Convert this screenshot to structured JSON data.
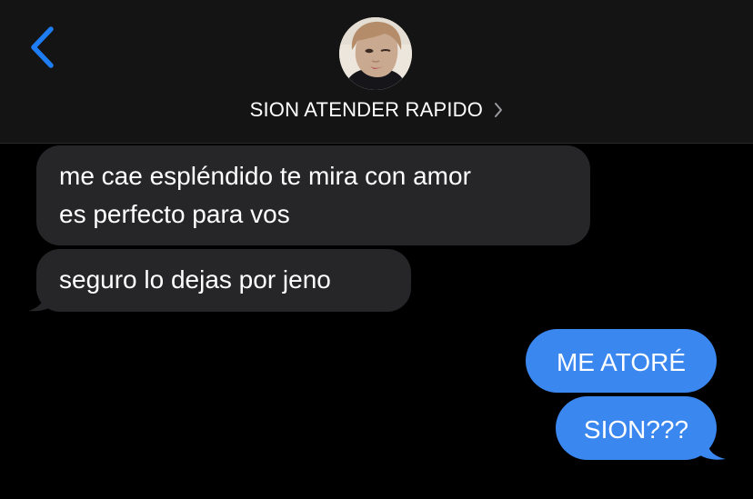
{
  "header": {
    "contact_name": "SION ATENDER RAPIDO",
    "back_icon": "chevron-left-icon",
    "chevron_icon": "chevron-right-icon"
  },
  "colors": {
    "background": "#000000",
    "header_bg": "#141414",
    "received_bubble": "#262629",
    "sent_bubble": "#3b87f0",
    "accent": "#1f7df4"
  },
  "messages": [
    {
      "direction": "received",
      "lines": [
        "me cae espléndido te mira con amor",
        "es perfecto para vos"
      ]
    },
    {
      "direction": "received",
      "lines": [
        "seguro lo dejas por jeno"
      ]
    },
    {
      "direction": "sent",
      "lines": [
        "ME ATORÉ"
      ]
    },
    {
      "direction": "sent",
      "lines": [
        "SION???"
      ]
    }
  ]
}
